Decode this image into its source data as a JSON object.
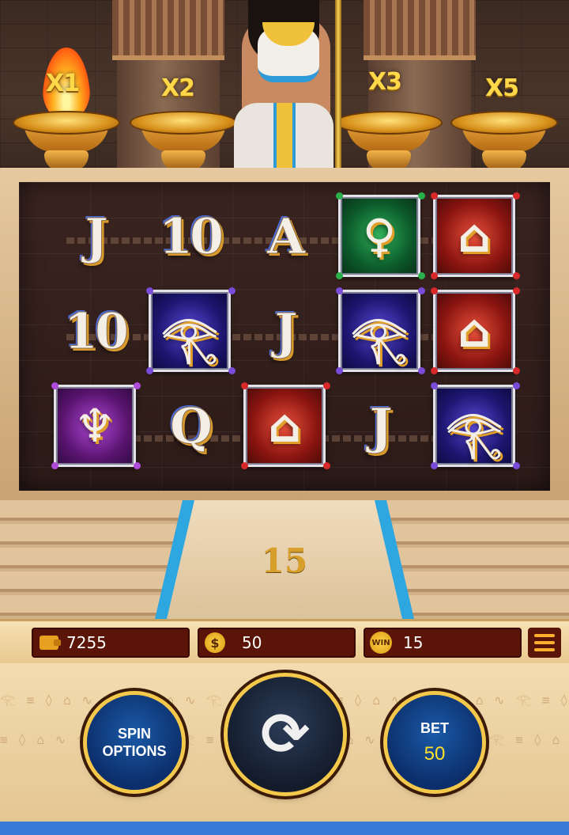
{
  "multipliers": [
    "X1",
    "X2",
    "X3",
    "X5"
  ],
  "reels": [
    [
      {
        "symbol": "J",
        "frame": "none"
      },
      {
        "symbol": "10",
        "frame": "none"
      },
      {
        "symbol": "A",
        "frame": "none"
      },
      {
        "symbol": "ankh-green",
        "frame": "green"
      },
      {
        "symbol": "vase-red",
        "frame": "red"
      }
    ],
    [
      {
        "symbol": "10",
        "frame": "none"
      },
      {
        "symbol": "eye-blue",
        "frame": "blue"
      },
      {
        "symbol": "J",
        "frame": "none"
      },
      {
        "symbol": "eye-blue",
        "frame": "blue"
      },
      {
        "symbol": "vase-red",
        "frame": "red"
      }
    ],
    [
      {
        "symbol": "chalice-purple",
        "frame": "purple"
      },
      {
        "symbol": "Q",
        "frame": "none"
      },
      {
        "symbol": "vase-red",
        "frame": "red"
      },
      {
        "symbol": "J",
        "frame": "none"
      },
      {
        "symbol": "eye-blue",
        "frame": "blue"
      }
    ]
  ],
  "free_spins_count": "15",
  "infobar": {
    "balance": "7255",
    "bet": "50",
    "win_badge": "WIN",
    "win": "15",
    "coin_symbol": "$"
  },
  "controls": {
    "spin_options_line1": "SPIN",
    "spin_options_line2": "OPTIONS",
    "bet_label": "BET",
    "bet_value": "50"
  },
  "colors": {
    "accent_gold": "#f4c84a",
    "panel_dark": "#5a1408",
    "button_blue": "#0c2e6a"
  }
}
